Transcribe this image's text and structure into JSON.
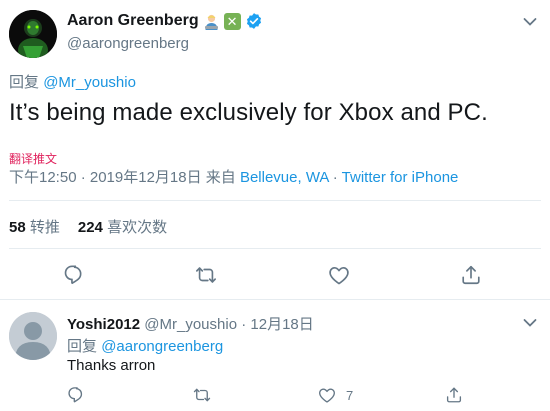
{
  "main_tweet": {
    "author_name": "Aaron Greenberg",
    "author_handle": "@aarongreenberg",
    "reply_prefix": "回复",
    "reply_to": "@Mr_youshio",
    "text": "It’s being made exclusively for Xbox and PC.",
    "translate_label": "翻译推文",
    "time": "下午12:50 · 2019年12月18日",
    "from_prefix": " 来自 ",
    "location": "Bellevue, WA",
    "separator": " · ",
    "source": "Twitter for iPhone",
    "retweets_count": "58",
    "retweets_label": "转推",
    "likes_count": "224",
    "likes_label": "喜欢次数"
  },
  "reply_tweet": {
    "author_name": "Yoshi2012",
    "author_handle": "@Mr_youshio",
    "date_separator": " · ",
    "date": "12月18日",
    "reply_prefix": "回复",
    "reply_to": "@aarongreenberg",
    "text": "Thanks arron",
    "likes_count": "7"
  },
  "colors": {
    "link": "#1b95e0",
    "translate": "#e0245e",
    "muted": "#657786",
    "verified": "#1da1f2",
    "emoji_check": "#77b255"
  },
  "icons": {
    "reply": "speech-bubble",
    "retweet": "two-arrows-loop",
    "like": "heart-outline",
    "share": "upload-arrow",
    "more": "chevron-down"
  }
}
